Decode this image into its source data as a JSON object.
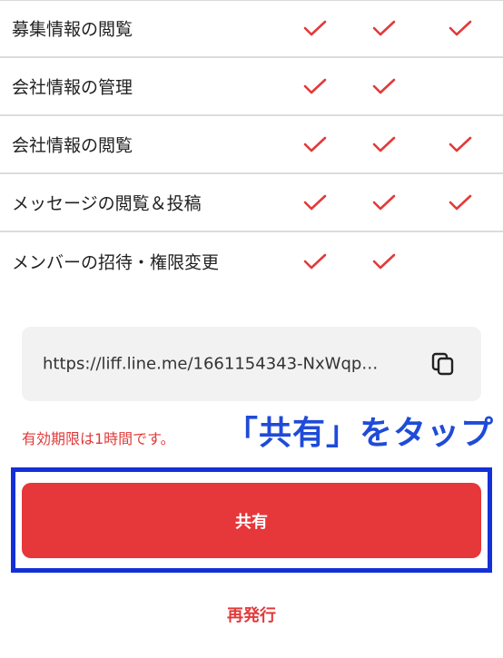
{
  "permissions": {
    "rows": [
      {
        "label": "募集情報の閲覧",
        "checks": [
          true,
          true,
          true
        ]
      },
      {
        "label": "会社情報の管理",
        "checks": [
          true,
          true,
          false
        ]
      },
      {
        "label": "会社情報の閲覧",
        "checks": [
          true,
          true,
          true
        ]
      },
      {
        "label": "メッセージの閲覧＆投稿",
        "checks": [
          true,
          true,
          true
        ]
      },
      {
        "label": "メンバーの招待・権限変更",
        "checks": [
          true,
          true,
          false
        ]
      }
    ]
  },
  "invite": {
    "url": "https://liff.line.me/1661154343-NxWqp…",
    "copy_icon": "copy-icon"
  },
  "expiry_note": "有効期限は1時間です。",
  "annotation": "「共有」をタップ",
  "share_button_label": "共有",
  "reissue_label": "再発行",
  "colors": {
    "accent_red": "#e6373a",
    "check_red": "#e23a3a",
    "annotation_blue": "#1f4bd8",
    "highlight_frame": "#1330d8"
  }
}
